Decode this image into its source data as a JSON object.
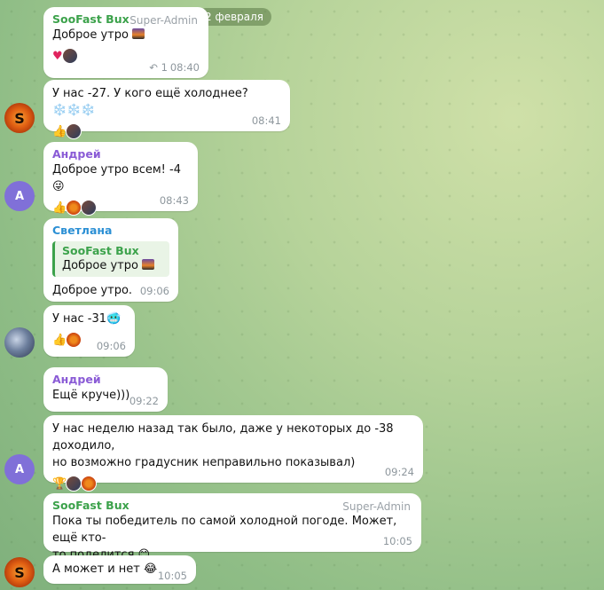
{
  "date_label": "2 февраля",
  "messages": [
    {
      "sender": "SooFast Bux",
      "role": "Super-Admin",
      "text": "Доброе утро",
      "reply_count": "1",
      "time": "08:40",
      "sender_color": "#3ca24b"
    },
    {
      "text": "У нас -27. У кого ещё холоднее?",
      "snow": "❄️❄️❄️",
      "time": "08:41"
    },
    {
      "sender": "Андрей",
      "text": "Доброе утро всем! -4",
      "emoji": "😜",
      "time": "08:43",
      "sender_color": "#8a5bd6"
    },
    {
      "sender": "Светлана",
      "quote_name": "SooFast Bux",
      "quote_text": "Доброе утро",
      "text": "Доброе утро.",
      "time": "09:06",
      "sender_color": "#2b8fd4"
    },
    {
      "text": "У нас  -31",
      "emoji": "🥶",
      "time": "09:06"
    },
    {
      "sender": "Андрей",
      "text": "Ещё круче)))",
      "time": "09:22",
      "sender_color": "#8a5bd6"
    },
    {
      "text_line1": "У нас неделю назад так было, даже у некоторых до -38 доходило,",
      "text_line2": "но возможно градусник неправильно показывал)",
      "time": "09:24"
    },
    {
      "sender": "SooFast Bux",
      "role": "Super-Admin",
      "text_line1": "Пока ты победитель по самой холодной погоде. Может, ещё кто-",
      "text_line2": "то поделится",
      "emoji": "😊",
      "time": "10:05",
      "sender_color": "#3ca24b"
    },
    {
      "text": "А может и нет",
      "emoji": "😂",
      "time": "10:05"
    }
  ],
  "avatars": {
    "andrey_letter": "А"
  }
}
